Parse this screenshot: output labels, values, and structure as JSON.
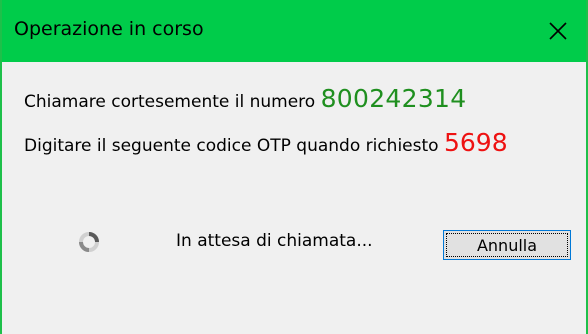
{
  "window": {
    "title": "Operazione in corso",
    "close_icon": "close-icon"
  },
  "message": {
    "call_text": "Chiamare cortesemente il numero",
    "phone_number": "800242314",
    "otp_text": "Digitare il seguente codice OTP quando richiesto",
    "otp_code": "5698"
  },
  "status": {
    "spinner_icon": "loading-spinner-icon",
    "text": "In attesa di chiamata..."
  },
  "buttons": {
    "cancel_label": "Annulla"
  },
  "colors": {
    "titlebar": "#00cc4a",
    "phone_number": "#1f8f1f",
    "otp_code": "#ee1111",
    "button_border": "#0078d7"
  }
}
